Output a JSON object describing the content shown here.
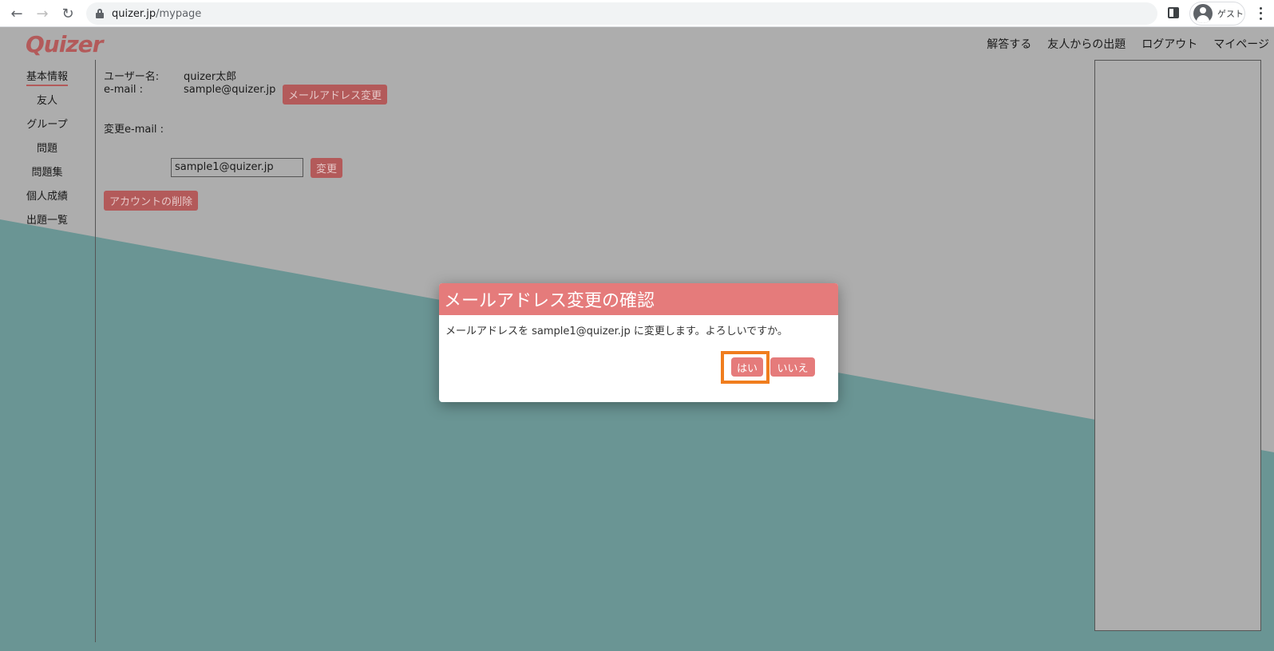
{
  "browser": {
    "url_host": "quizer.jp",
    "url_path": "/mypage",
    "profile_label": "ゲスト"
  },
  "site": {
    "logo": "Quizer",
    "top_nav": [
      "解答する",
      "友人からの出題",
      "ログアウト",
      "マイページ"
    ]
  },
  "sidebar": {
    "items": [
      {
        "label": "基本情報",
        "active": true
      },
      {
        "label": "友人",
        "active": false
      },
      {
        "label": "グループ",
        "active": false
      },
      {
        "label": "問題",
        "active": false
      },
      {
        "label": "問題集",
        "active": false
      },
      {
        "label": "個人成績",
        "active": false
      },
      {
        "label": "出題一覧",
        "active": false
      }
    ]
  },
  "profile": {
    "username_label": "ユーザー名:",
    "username_value": "quizer太郎",
    "email_label": "e-mail :",
    "email_value": "sample@quizer.jp",
    "change_email_button": "メールアドレス変更",
    "new_email_label": "変更e-mail :",
    "new_email_value": "sample1@quizer.jp",
    "change_button": "変更",
    "delete_account_button": "アカウントの削除"
  },
  "modal": {
    "title": "メールアドレス変更の確認",
    "message": "メールアドレスを sample1@quizer.jp に変更します。よろしいですか。",
    "yes_label": "はい",
    "no_label": "いいえ"
  },
  "colors": {
    "accent": "#b35a5a",
    "modal_header": "#e57b7b",
    "overlay_gray": "#adadad",
    "overlay_teal": "#6a9594",
    "highlight": "#f07d1e"
  }
}
